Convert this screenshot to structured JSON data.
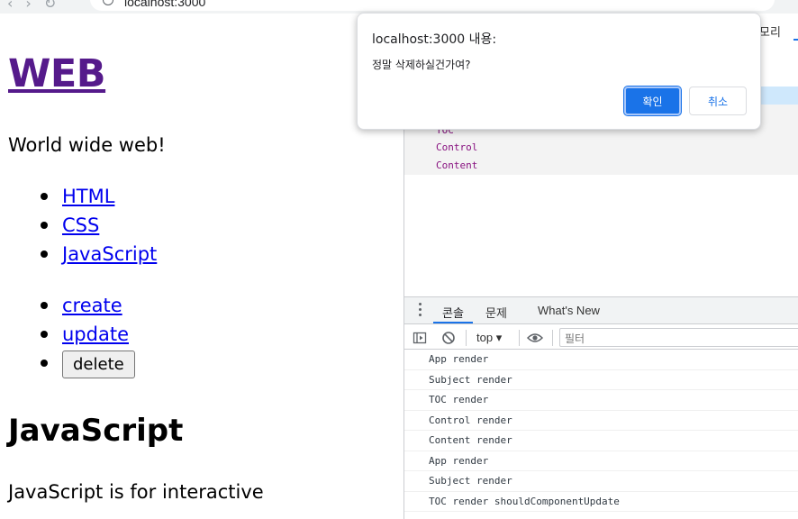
{
  "browser": {
    "url": "localhost:3000",
    "back_icon": "arrow-left-icon",
    "forward_icon": "arrow-right-icon",
    "reload_icon": "reload-icon",
    "secure_icon": "info-icon"
  },
  "page": {
    "title": "WEB",
    "tagline": "World wide web!",
    "toc": [
      "HTML",
      "CSS",
      "JavaScript"
    ],
    "controls": {
      "create": "create",
      "update": "update",
      "delete": "delete"
    },
    "content_title": "JavaScript",
    "content_desc": "JavaScript is for interactive"
  },
  "devtools": {
    "top_tab": "모리",
    "elements": [
      "TOC",
      "Control",
      "Content"
    ],
    "drawer_tabs": [
      "콘솔",
      "문제",
      "What's New"
    ],
    "context": "top",
    "filter_placeholder": "필터",
    "console_messages": [
      "App render",
      "Subject render",
      "TOC render",
      "Control render",
      "Content render",
      "App render",
      "Subject render",
      "TOC render shouldComponentUpdate"
    ]
  },
  "dialog": {
    "title": "localhost:3000 내용:",
    "message": "정말 삭제하실건가여?",
    "ok_label": "확인",
    "cancel_label": "취소"
  },
  "colors": {
    "accent": "#1a73e8",
    "visited_link": "#551a8b",
    "link": "#0000ee"
  }
}
